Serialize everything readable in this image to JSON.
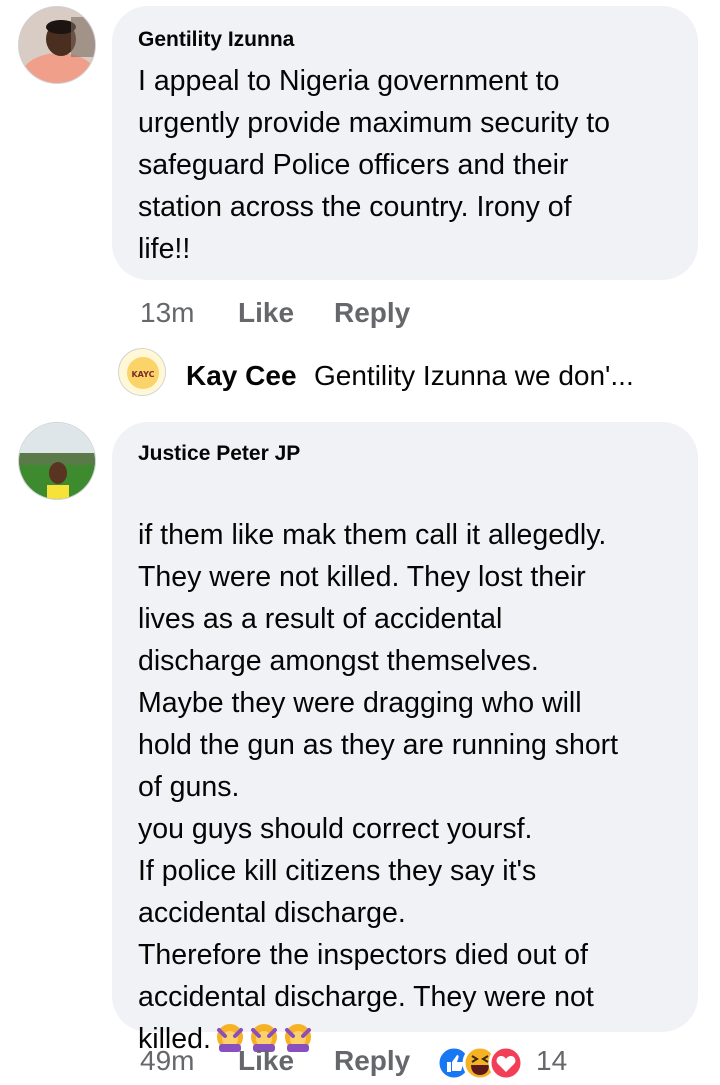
{
  "comments": [
    {
      "author": "Gentility Izunna",
      "text": "I appeal to Nigeria government to\nurgently provide maximum security to\nsafeguard  Police officers and their\nstation across the country. Irony of\nlife!!",
      "time": "13m",
      "like_label": "Like",
      "reply_label": "Reply"
    },
    {
      "author": "Justice Peter JP",
      "text": "if them like mak them call it allegedly.\nThey were not killed. They lost their\nlives as a result of accidental\ndischarge amongst themselves.\nMaybe they were dragging who will\nhold the gun as they are running short\nof guns.\nyou guys should correct yoursf.\nIf police kill citizens they say it's\naccidental discharge.\nTherefore the inspectors died out of\naccidental discharge. They were not\nkilled.",
      "time": "49m",
      "like_label": "Like",
      "reply_label": "Reply",
      "reaction_count": "14"
    }
  ],
  "reply_preview": {
    "author": "Kay Cee",
    "snippet": "Gentility Izunna we don'...",
    "avatar_text": "KAYC"
  },
  "colors": {
    "bubble": "#f0f2f5",
    "meta": "#65676b",
    "like_blue": "#1877f2",
    "haha_yellow": "#f7b125",
    "love_red": "#f33e58"
  }
}
